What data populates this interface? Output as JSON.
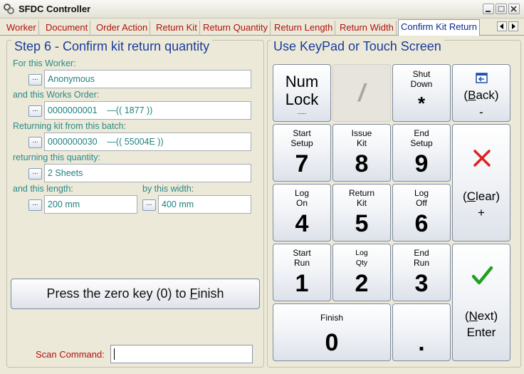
{
  "window": {
    "title": "SFDC Controller"
  },
  "tabs": [
    "Worker",
    "Document",
    "Order Action",
    "Return Kit",
    "Return Quantity",
    "Return Length",
    "Return Width",
    "Confirm Kit Return"
  ],
  "left_panel": {
    "title": "Step 6 - Confirm kit return quantity",
    "lookup_label": "...",
    "fields": {
      "worker": {
        "label": "For this Worker:",
        "value": "Anonymous"
      },
      "works_order": {
        "label": "and this Works Order:",
        "value": "0000000001    —(( 1877 ))"
      },
      "batch": {
        "label": "Returning kit from this batch:",
        "value": "0000000030    —(( 55004E ))"
      },
      "quantity": {
        "label": "returning this quantity:",
        "value": "2 Sheets"
      },
      "length": {
        "label": "and this length:",
        "value": "200 mm"
      },
      "width": {
        "label": "by this width:",
        "value": "400 mm"
      }
    },
    "finish_button": {
      "before": "Press the zero key (0) to ",
      "accel": "F",
      "after": "inish"
    },
    "scan": {
      "label": "Scan Command:",
      "value": ""
    }
  },
  "keypad": {
    "title": "Use KeyPad or Touch Screen",
    "numlock": {
      "line1": "Num",
      "line2": "Lock",
      "sub": "....."
    },
    "slash": "/",
    "shutdown": {
      "line1": "Shut",
      "line2": "Down",
      "symbol": "*"
    },
    "back": {
      "accel": "B",
      "rest": "ack)",
      "open": "(",
      "symbol": "-"
    },
    "k7": {
      "line1": "Start",
      "line2": "Setup",
      "digit": "7"
    },
    "k8": {
      "line1": "Issue",
      "line2": "Kit",
      "digit": "8"
    },
    "k9": {
      "line1": "End",
      "line2": "Setup",
      "digit": "9"
    },
    "clear": {
      "open": "(",
      "accel": "C",
      "rest": "lear)",
      "symbol": "+"
    },
    "k4": {
      "line1": "Log",
      "line2": "On",
      "digit": "4"
    },
    "k5": {
      "line1": "Return",
      "line2": "Kit",
      "digit": "5"
    },
    "k6": {
      "line1": "Log",
      "line2": "Off",
      "digit": "6"
    },
    "k1": {
      "line1": "Start",
      "line2": "Run",
      "digit": "1"
    },
    "k2": {
      "line1": "Log",
      "line2": "Qty",
      "digit": "2"
    },
    "k3": {
      "line1": "End",
      "line2": "Run",
      "digit": "3"
    },
    "next": {
      "open": "(",
      "accel": "N",
      "rest": "ext)",
      "line2": "Enter"
    },
    "k0": {
      "line1": "Finish",
      "digit": "0"
    },
    "dot": "."
  },
  "colors": {
    "label_teal": "#2a8a8a",
    "tab_red": "#b01010",
    "title_blue": "#1a3c9c",
    "clear_red": "#e02020",
    "check_green": "#20a020"
  }
}
